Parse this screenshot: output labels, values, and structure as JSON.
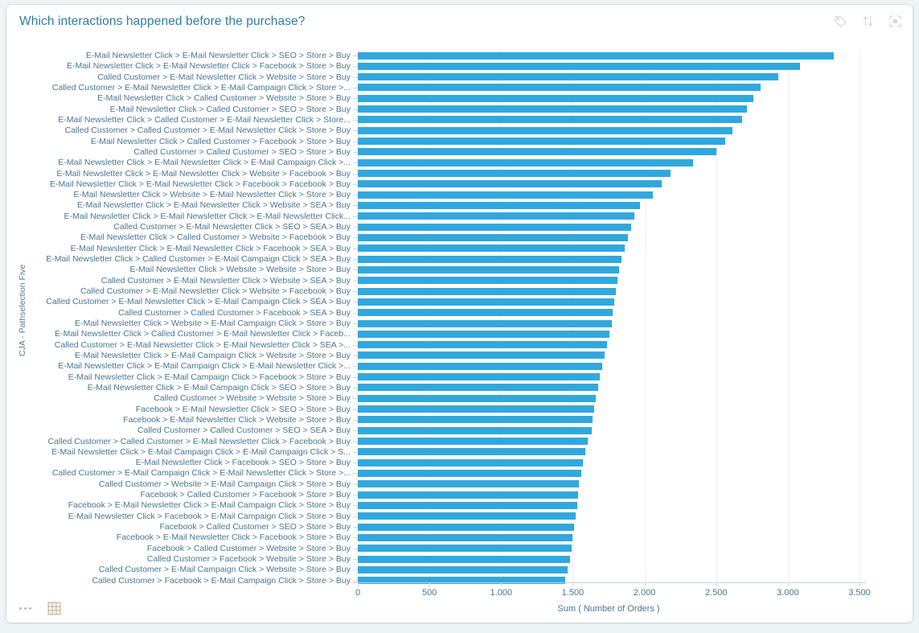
{
  "header": {
    "title": "Which interactions happened before the purchase?",
    "title_color": "#2e7ca6",
    "tools": [
      {
        "name": "tag-icon",
        "label": "Tag"
      },
      {
        "name": "sort-icon",
        "label": "Sort"
      },
      {
        "name": "fullscreen-icon",
        "label": "Fullscreen"
      }
    ]
  },
  "footer": {
    "tools": [
      {
        "name": "more-options-icon",
        "label": "More options"
      },
      {
        "name": "table-view-icon",
        "label": "Table view"
      }
    ]
  },
  "chart_data": {
    "type": "bar",
    "orientation": "horizontal",
    "title": "Which interactions happened before the purchase?",
    "xlabel": "Sum ( Number of Orders )",
    "ylabel": "CJA - Pathselection Five",
    "xlim": [
      0,
      3500
    ],
    "xticks": [
      0,
      500,
      1000,
      1500,
      2000,
      2500,
      3000,
      3500
    ],
    "xticklabels": [
      "0",
      "500",
      "1.000",
      "1.500",
      "2.000",
      "2.500",
      "3.000",
      "3.500"
    ],
    "grid": true,
    "legend": false,
    "bar_color": "#31a8dd",
    "categories": [
      "E-Mail Newsletter Click > E-Mail Newsletter Click > SEO > Store > Buy",
      "E-Mail Newsletter Click > E-Mail Newsletter Click > Facebook > Store > Buy",
      "Called Customer > E-Mail Newsletter Click > Website > Store > Buy",
      "Called Customer > E-Mail Newsletter Click > E-Mail Campaign Click > Store >...",
      "E-Mail Newsletter Click > Called Customer > Website > Store > Buy",
      "E-Mail Newsletter Click > Called Customer > SEO > Store > Buy",
      "E-Mail Newsletter Click > Called Customer > E-Mail Newsletter Click > Store...",
      "Called Customer > Called Customer > E-Mail Newsletter Click > Store > Buy",
      "E-Mail Newsletter Click > Called Customer > Facebook > Store > Buy",
      "Called Customer > Called Customer > SEO > Store > Buy",
      "E-Mail Newsletter Click > E-Mail Newsletter Click > E-Mail Campaign Click >...",
      "E-Mail Newsletter Click > E-Mail Newsletter Click > Website > Facebook > Buy",
      "E-Mail Newsletter Click > E-Mail Newsletter Click > Facebook > Facebook > Buy",
      "E-Mail Newsletter Click > Website > E-Mail Newsletter Click > Store > Buy",
      "E-Mail Newsletter Click > E-Mail Newsletter Click > Website > SEA > Buy",
      "E-Mail Newsletter Click > E-Mail Newsletter Click > E-Mail Newsletter Click...",
      "Called Customer > E-Mail Newsletter Click > SEO > SEA > Buy",
      "E-Mail Newsletter Click > Called Customer > Website > Facebook > Buy",
      "E-Mail Newsletter Click > E-Mail Newsletter Click > Facebook > SEA > Buy",
      "E-Mail Newsletter Click > Called Customer > E-Mail Campaign Click > SEA > Buy",
      "E-Mail Newsletter Click > Website > Website > Store > Buy",
      "Called Customer > E-Mail Newsletter Click > Website > SEA > Buy",
      "Called Customer > E-Mail Newsletter Click > Website > Facebook > Buy",
      "Called Customer > E-Mail Newsletter Click > E-Mail Campaign Click > SEA > Buy",
      "Called Customer > Called Customer > Facebook > SEA > Buy",
      "E-Mail Newsletter Click > Website > E-Mail Campaign Click > Store > Buy",
      "E-Mail Newsletter Click > Called Customer > E-Mail Newsletter Click > Faceb...",
      "Called Customer > E-Mail Newsletter Click > E-Mail Newsletter Click > SEA >...",
      "E-Mail Newsletter Click > E-Mail Campaign Click > Website > Store > Buy",
      "E-Mail Newsletter Click > E-Mail Campaign Click > E-Mail Newsletter Click >...",
      "E-Mail Newsletter Click > E-Mail Campaign Click > Facebook > Store > Buy",
      "E-Mail Newsletter Click > E-Mail Campaign Click > SEO > Store > Buy",
      "Called Customer > Website > Website > Store > Buy",
      "Facebook > E-Mail Newsletter Click > SEO > Store > Buy",
      "Facebook > E-Mail Newsletter Click > Website > Store > Buy",
      "Called Customer > Called Customer > SEO > SEA > Buy",
      "Called Customer > Called Customer > E-Mail Newsletter Click > Facebook > Buy",
      "E-Mail Newsletter Click > E-Mail Campaign Click > E-Mail Campaign Click > S...",
      "E-Mail Newsletter Click > Facebook > SEO > Store > Buy",
      "Called Customer > E-Mail Campaign Click > E-Mail Newsletter Click > Store >...",
      "Called Customer > Website > E-Mail Campaign Click > Store > Buy",
      "Facebook > Called Customer > Facebook > Store > Buy",
      "Facebook > E-Mail Newsletter Click > E-Mail Campaign Click > Store > Buy",
      "E-Mail Newsletter Click > Facebook > E-Mail Campaign Click > Store > Buy",
      "Facebook > Called Customer > SEO > Store > Buy",
      "Facebook > E-Mail Newsletter Click > Facebook > Store > Buy",
      "Facebook > Called Customer > Website > Store > Buy",
      "Called Customer > Facebook > Website > Store > Buy",
      "Called Customer > E-Mail Campaign Click > Website > Store > Buy",
      "Called Customer > Facebook > E-Mail Campaign Click > Store > Buy"
    ],
    "values": [
      3318,
      3083,
      2935,
      2810,
      2760,
      2715,
      2680,
      2615,
      2565,
      2500,
      2340,
      2180,
      2120,
      2060,
      1970,
      1930,
      1905,
      1885,
      1860,
      1840,
      1825,
      1810,
      1800,
      1790,
      1780,
      1770,
      1755,
      1740,
      1720,
      1705,
      1690,
      1675,
      1660,
      1650,
      1640,
      1630,
      1605,
      1590,
      1570,
      1560,
      1545,
      1535,
      1530,
      1520,
      1510,
      1500,
      1490,
      1480,
      1465,
      1445
    ]
  }
}
